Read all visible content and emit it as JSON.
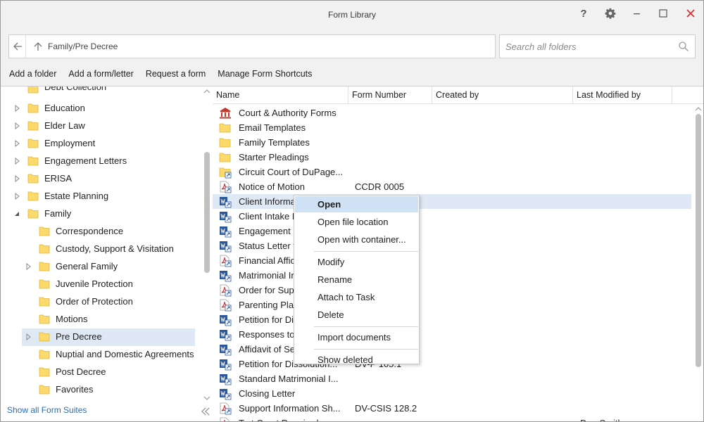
{
  "window": {
    "title": "Form Library",
    "path": "Family/Pre Decree",
    "search_placeholder": "Search all folders"
  },
  "toolbar": {
    "actions": [
      "Add a folder",
      "Add a form/letter",
      "Request a form",
      "Manage Form Shortcuts"
    ]
  },
  "tree": {
    "partial_top": "Debt Collection",
    "items": [
      {
        "label": "Education",
        "level": 0,
        "expander": "collapsed"
      },
      {
        "label": "Elder Law",
        "level": 0,
        "expander": "collapsed"
      },
      {
        "label": "Employment",
        "level": 0,
        "expander": "collapsed"
      },
      {
        "label": "Engagement Letters",
        "level": 0,
        "expander": "collapsed"
      },
      {
        "label": "ERISA",
        "level": 0,
        "expander": "collapsed"
      },
      {
        "label": "Estate Planning",
        "level": 0,
        "expander": "collapsed"
      },
      {
        "label": "Family",
        "level": 0,
        "expander": "expanded"
      },
      {
        "label": "Correspondence",
        "level": 1,
        "expander": "none"
      },
      {
        "label": "Custody, Support & Visitation",
        "level": 1,
        "expander": "none"
      },
      {
        "label": "General Family",
        "level": 1,
        "expander": "collapsed"
      },
      {
        "label": "Juvenile Protection",
        "level": 1,
        "expander": "none"
      },
      {
        "label": "Order of Protection",
        "level": 1,
        "expander": "none"
      },
      {
        "label": "Motions",
        "level": 1,
        "expander": "none"
      },
      {
        "label": "Pre Decree",
        "level": 1,
        "expander": "collapsed",
        "selected": true
      },
      {
        "label": "Nuptial and Domestic Agreements",
        "level": 1,
        "expander": "none"
      },
      {
        "label": "Post Decree",
        "level": 1,
        "expander": "none"
      },
      {
        "label": "Favorites",
        "level": 1,
        "expander": "none"
      }
    ],
    "show_all_label": "Show all Form Suites"
  },
  "list": {
    "columns": [
      "Name",
      "Form Number",
      "Created by",
      "Last Modified by"
    ],
    "rows": [
      {
        "icon": "court-icon",
        "name": "Court & Authority Forms",
        "number": "",
        "modified": ""
      },
      {
        "icon": "folder-icon",
        "name": "Email Templates",
        "number": "",
        "modified": ""
      },
      {
        "icon": "folder-icon",
        "name": "Family Templates",
        "number": "",
        "modified": ""
      },
      {
        "icon": "folder-icon",
        "name": "Starter Pleadings",
        "number": "",
        "modified": ""
      },
      {
        "icon": "folder-shortcut-icon",
        "name": "Circuit Court of DuPage...",
        "number": "",
        "modified": ""
      },
      {
        "icon": "pdf-icon",
        "name": "Notice of Motion",
        "number": "CCDR 0005",
        "modified": ""
      },
      {
        "icon": "word-icon",
        "name": "Client Informa",
        "number": "",
        "modified": "",
        "highlight": true
      },
      {
        "icon": "word-icon",
        "name": "Client Intake F",
        "number": "",
        "modified": ""
      },
      {
        "icon": "word-icon",
        "name": "Engagement L",
        "number": "",
        "modified": ""
      },
      {
        "icon": "word-icon",
        "name": "Status Letter t",
        "number": "",
        "modified": ""
      },
      {
        "icon": "pdf-icon",
        "name": "Financial Affic",
        "number": "",
        "modified": ""
      },
      {
        "icon": "word-icon",
        "name": "Matrimonial In",
        "number": "",
        "modified": ""
      },
      {
        "icon": "pdf-icon",
        "name": "Order for Sup",
        "number": "",
        "modified": ""
      },
      {
        "icon": "pdf-icon",
        "name": "Parenting Plan",
        "number": "",
        "modified": ""
      },
      {
        "icon": "word-icon",
        "name": "Petition for Di",
        "number": "",
        "modified": ""
      },
      {
        "icon": "word-icon",
        "name": "Responses to",
        "number": "",
        "modified": ""
      },
      {
        "icon": "word-icon",
        "name": "Affidavit of Se",
        "number": "",
        "modified": ""
      },
      {
        "icon": "word-icon",
        "name": "Petition for Dissolution...",
        "number": "DV-P 105.1",
        "modified": ""
      },
      {
        "icon": "word-icon",
        "name": "Standard Matrimonial I...",
        "number": "",
        "modified": ""
      },
      {
        "icon": "word-icon",
        "name": "Closing Letter",
        "number": "",
        "modified": ""
      },
      {
        "icon": "pdf-icon",
        "name": "Support Information Sh...",
        "number": "DV-CSIS 128.2",
        "modified": ""
      },
      {
        "icon": "pdf-icon",
        "name": "Tort Court Required",
        "number": "",
        "modified": "Dan Smith"
      }
    ]
  },
  "context_menu": {
    "items": [
      {
        "label": "Open",
        "bold": true,
        "active": true
      },
      {
        "label": "Open file location"
      },
      {
        "label": "Open with container..."
      },
      {
        "sep": true
      },
      {
        "label": "Modify"
      },
      {
        "label": "Rename"
      },
      {
        "label": "Attach to Task"
      },
      {
        "label": "Delete"
      },
      {
        "sep": true
      },
      {
        "label": "Import documents"
      },
      {
        "sep": true
      },
      {
        "label": "Show deleted"
      }
    ]
  },
  "colors": {
    "selection": "#dfe9f6",
    "menu_active": "#cfe1f5",
    "folder": "#fbd96a",
    "word": "#2b579a",
    "pdf": "#d32f2f",
    "close": "#d32f2f"
  }
}
